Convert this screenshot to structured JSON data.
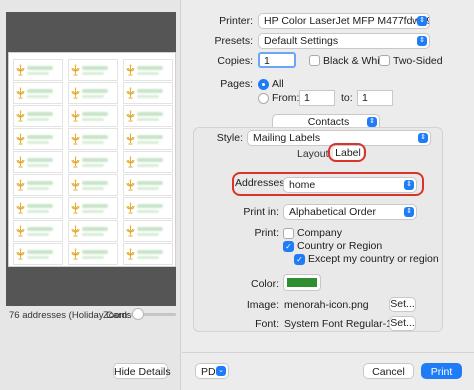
{
  "print": {
    "printer_label": "Printer:",
    "printer_value": "HP Color LaserJet MFP M477fdw (9E69...",
    "presets_label": "Presets:",
    "presets_value": "Default Settings",
    "copies_label": "Copies:",
    "copies_value": "1",
    "bw_label": "Black & White",
    "twosided_label": "Two-Sided",
    "pages_label": "Pages:",
    "pages_all": "All",
    "pages_from_label": "From:",
    "pages_from_value": "1",
    "pages_to_label": "to:",
    "pages_to_value": "1",
    "app_menu": "Contacts",
    "style_label": "Style:",
    "style_value": "Mailing Labels",
    "tab_layout": "Layout",
    "tab_label": "Label",
    "addresses_label": "Addresses:",
    "addresses_value": "home",
    "printin_label": "Print in:",
    "printin_value": "Alphabetical Order",
    "print_label": "Print:",
    "company": "Company",
    "country_region": "Country or Region",
    "except_country": "Except my country or region",
    "color_label": "Color:",
    "color_value": "#2f8f2f",
    "image_label": "Image:",
    "image_value": "menorah-icon.png",
    "font_label": "Font:",
    "font_value": "System Font Regular-12.0",
    "set_button": "Set...",
    "pdf_button": "PDF",
    "cancel_button": "Cancel",
    "print_button": "Print"
  },
  "preview": {
    "caption": "76 addresses (Holiday Cards",
    "zoom_label": "Zoom:",
    "hide_details": "Hide Details"
  },
  "colors": {
    "accent": "#1f7cf6",
    "highlight": "#d9342b"
  }
}
